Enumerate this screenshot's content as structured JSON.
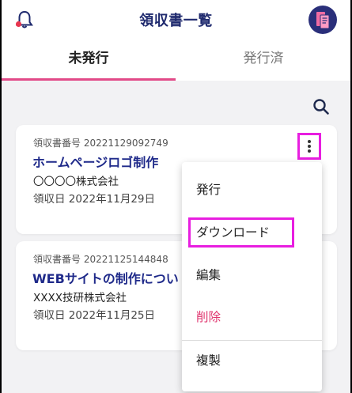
{
  "header": {
    "title": "領収書一覧",
    "bell_icon": "bell-icon",
    "avatar_icon": "receipt-avatar-icon"
  },
  "tabs": [
    {
      "label": "未発行",
      "active": true
    },
    {
      "label": "発行済",
      "active": false
    }
  ],
  "search": {
    "icon": "search-icon"
  },
  "receipts": [
    {
      "number": "領収書番号 20221129092749",
      "name": "ホームページロゴ制作",
      "company": "〇〇〇〇株式会社",
      "date": "領収日 2022年11月29日"
    },
    {
      "number": "領収書番号 20221125144848",
      "name": "WEBサイトの制作につい",
      "company": "XXXX技研株式会社",
      "date": "領収日 2022年11月25日"
    }
  ],
  "menu": {
    "items": [
      {
        "label": "発行"
      },
      {
        "label": "ダウンロード",
        "highlighted": true
      },
      {
        "label": "編集"
      },
      {
        "label": "削除",
        "danger": true
      },
      {
        "label": "複製"
      }
    ]
  },
  "colors": {
    "accent": "#e24a88",
    "title": "#1f2a6e",
    "link": "#1f2a8a",
    "danger": "#e0356f",
    "highlight": "#e81ee0"
  }
}
